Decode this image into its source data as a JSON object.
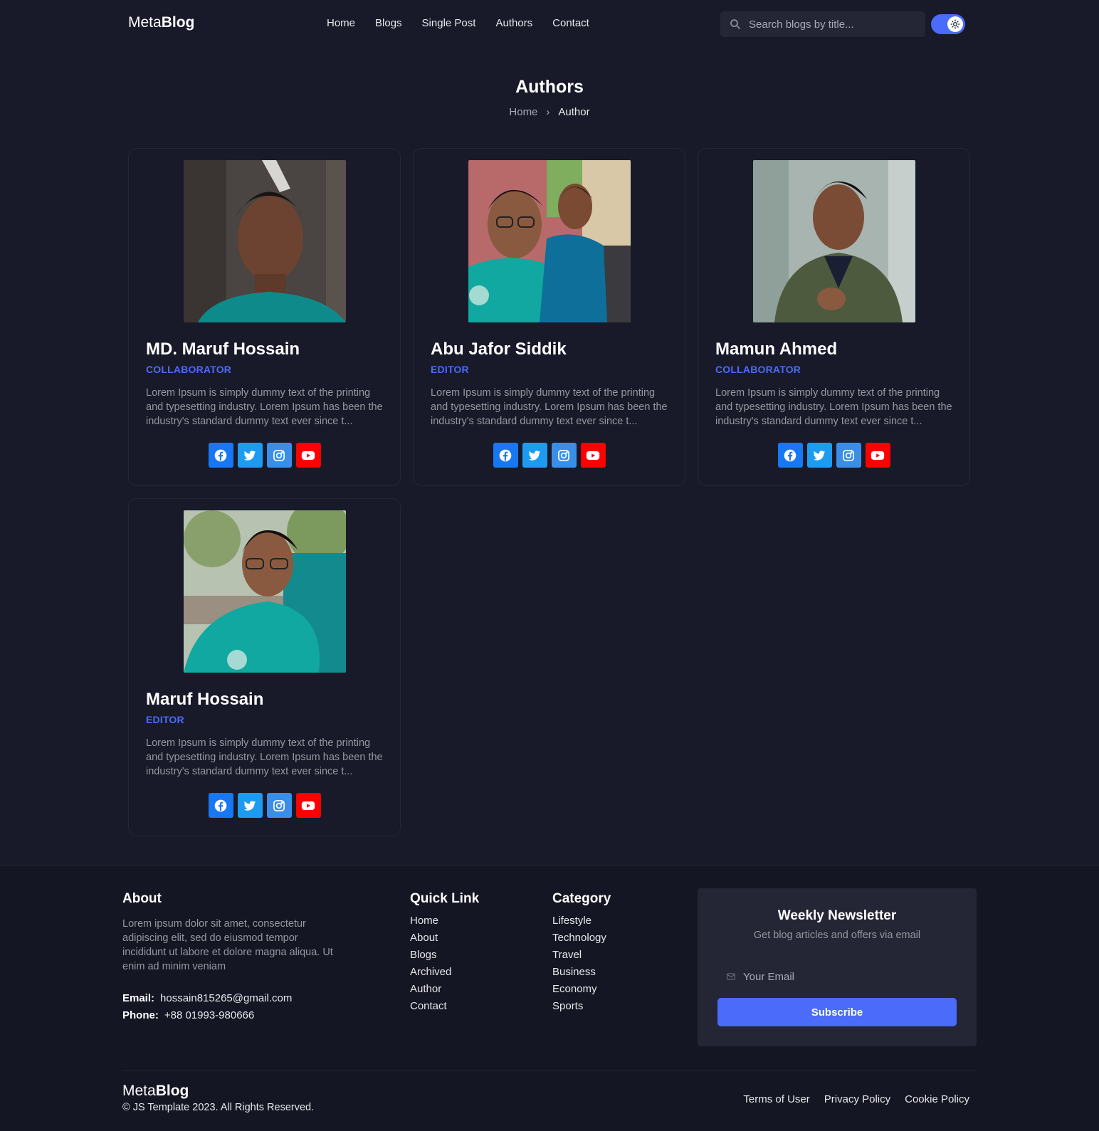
{
  "header": {
    "logo_light": "Meta",
    "logo_bold": "Blog",
    "nav": [
      "Home",
      "Blogs",
      "Single Post",
      "Authors",
      "Contact"
    ],
    "search_placeholder": "Search blogs by title..."
  },
  "page": {
    "title": "Authors",
    "breadcrumb_home": "Home",
    "breadcrumb_current": "Author"
  },
  "authors": [
    {
      "name": "MD. Maruf Hossain",
      "role": "COLLABORATOR",
      "bio": "Lorem Ipsum is simply dummy text of the printing and typesetting industry. Lorem Ipsum has been the industry's standard dummy text ever since t..."
    },
    {
      "name": "Abu Jafor Siddik",
      "role": "EDITOR",
      "bio": "Lorem Ipsum is simply dummy text of the printing and typesetting industry. Lorem Ipsum has been the industry's standard dummy text ever since t..."
    },
    {
      "name": "Mamun Ahmed",
      "role": "COLLABORATOR",
      "bio": "Lorem Ipsum is simply dummy text of the printing and typesetting industry. Lorem Ipsum has been the industry's standard dummy text ever since t..."
    },
    {
      "name": "Maruf Hossain",
      "role": "EDITOR",
      "bio": "Lorem Ipsum is simply dummy text of the printing and typesetting industry. Lorem Ipsum has been the industry's standard dummy text ever since t..."
    }
  ],
  "socials": [
    "facebook-icon",
    "twitter-icon",
    "instagram-icon",
    "youtube-icon"
  ],
  "footer": {
    "about_title": "About",
    "about_text": "Lorem ipsum dolor sit amet, consectetur adipiscing elit, sed do eiusmod tempor incididunt ut labore et dolore magna aliqua. Ut enim ad minim veniam",
    "email_label": "Email:",
    "email_value": "hossain815265@gmail.com",
    "phone_label": "Phone:",
    "phone_value": "+88 01993-980666",
    "quick_link_title": "Quick Link",
    "quick_links": [
      "Home",
      "About",
      "Blogs",
      "Archived",
      "Author",
      "Contact"
    ],
    "category_title": "Category",
    "categories": [
      "Lifestyle",
      "Technology",
      "Travel",
      "Business",
      "Economy",
      "Sports"
    ],
    "newsletter_title": "Weekly Newsletter",
    "newsletter_subtitle": "Get blog articles and offers via email",
    "newsletter_placeholder": "Your Email",
    "subscribe_label": "Subscribe",
    "logo_light": "Meta",
    "logo_bold": "Blog",
    "copyright": "© JS Template 2023. All Rights Reserved.",
    "legal": [
      "Terms of User",
      "Privacy Policy",
      "Cookie Policy"
    ]
  },
  "colors": {
    "background": "#181a2a",
    "accent": "#4b6bfb",
    "facebook": "#1877f2",
    "twitter": "#1d9bf0",
    "instagram": "#3b8ee8",
    "youtube": "#ff0000"
  }
}
